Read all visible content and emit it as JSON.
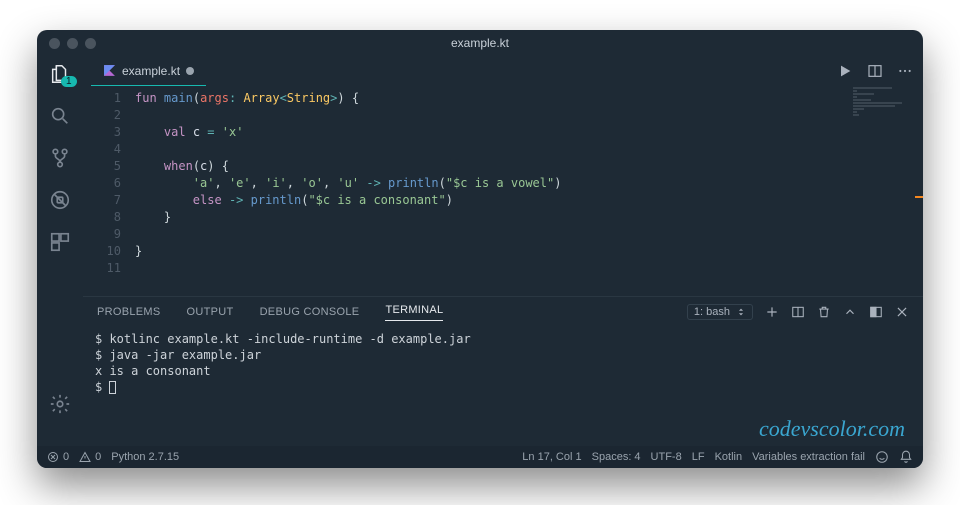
{
  "window": {
    "title": "example.kt"
  },
  "tab": {
    "label": "example.kt"
  },
  "sidebar": {
    "badge": "1"
  },
  "code": {
    "lines": [
      "1",
      "2",
      "3",
      "4",
      "5",
      "6",
      "7",
      "8",
      "9",
      "10",
      "11"
    ],
    "tokens": [
      [
        [
          "kw",
          "fun"
        ],
        [
          "",
          ""
        ],
        [
          "fn",
          "main"
        ],
        [
          "pu",
          "("
        ],
        [
          "pn",
          "args"
        ],
        [
          "op",
          ":"
        ],
        [
          "",
          ""
        ],
        [
          "ty",
          "Array"
        ],
        [
          "op",
          "<"
        ],
        [
          "ty",
          "String"
        ],
        [
          "op",
          ">"
        ],
        [
          "pu",
          ")"
        ],
        [
          "",
          ""
        ],
        [
          "pu",
          "{"
        ]
      ],
      [],
      [
        [
          "",
          "    "
        ],
        [
          "kw",
          "val"
        ],
        [
          "",
          ""
        ],
        [
          "id",
          "c"
        ],
        [
          "",
          ""
        ],
        [
          "op",
          "="
        ],
        [
          "",
          ""
        ],
        [
          "st",
          "'x'"
        ]
      ],
      [],
      [
        [
          "",
          "    "
        ],
        [
          "kw",
          "when"
        ],
        [
          "pu",
          "("
        ],
        [
          "id",
          "c"
        ],
        [
          "pu",
          ")"
        ],
        [
          "",
          ""
        ],
        [
          "pu",
          "{"
        ]
      ],
      [
        [
          "",
          "        "
        ],
        [
          "st",
          "'a'"
        ],
        [
          "pu",
          ","
        ],
        [
          "",
          ""
        ],
        [
          "st",
          "'e'"
        ],
        [
          "pu",
          ","
        ],
        [
          "",
          ""
        ],
        [
          "st",
          "'i'"
        ],
        [
          "pu",
          ","
        ],
        [
          "",
          ""
        ],
        [
          "st",
          "'o'"
        ],
        [
          "pu",
          ","
        ],
        [
          "",
          ""
        ],
        [
          "st",
          "'u'"
        ],
        [
          "",
          ""
        ],
        [
          "op",
          "->"
        ],
        [
          "",
          ""
        ],
        [
          "fn",
          "println"
        ],
        [
          "pu",
          "("
        ],
        [
          "st",
          "\"$c is a vowel\""
        ],
        [
          "pu",
          ")"
        ]
      ],
      [
        [
          "",
          "        "
        ],
        [
          "kw",
          "else"
        ],
        [
          "",
          ""
        ],
        [
          "op",
          "->"
        ],
        [
          "",
          ""
        ],
        [
          "fn",
          "println"
        ],
        [
          "pu",
          "("
        ],
        [
          "st",
          "\"$c is a consonant\""
        ],
        [
          "pu",
          ")"
        ]
      ],
      [
        [
          "",
          "    "
        ],
        [
          "pu",
          "}"
        ]
      ],
      [],
      [
        [
          "pu",
          "}"
        ]
      ],
      []
    ]
  },
  "panel": {
    "tabs": [
      "PROBLEMS",
      "OUTPUT",
      "DEBUG CONSOLE",
      "TERMINAL"
    ],
    "active": 3,
    "terminalSelector": "1: bash",
    "terminal": [
      "$ kotlinc example.kt -include-runtime -d example.jar",
      "$ java -jar example.jar",
      "x is a consonant",
      "$ "
    ]
  },
  "watermark": "codevscolor.com",
  "status": {
    "errors": "0",
    "warnings": "0",
    "python": "Python 2.7.15",
    "position": "Ln 17, Col 1",
    "spaces": "Spaces: 4",
    "encoding": "UTF-8",
    "eol": "LF",
    "language": "Kotlin",
    "extra": "Variables extraction fail"
  }
}
